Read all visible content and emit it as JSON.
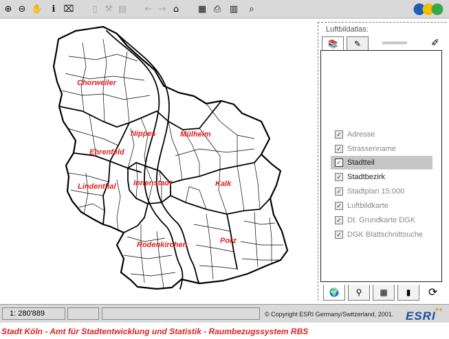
{
  "toolbar": {
    "buttons": [
      {
        "name": "zoom-in-icon",
        "glyph": "⊕"
      },
      {
        "name": "zoom-out-icon",
        "glyph": "⊖"
      },
      {
        "name": "pan-hand-icon",
        "glyph": "✋"
      },
      {
        "name": "info-icon",
        "glyph": "ℹ"
      },
      {
        "name": "measure-icon",
        "glyph": "⌧"
      },
      {
        "name": "select-icon",
        "glyph": "▯"
      },
      {
        "name": "query-icon",
        "glyph": "⚒"
      },
      {
        "name": "layer-query-icon",
        "glyph": "▤"
      },
      {
        "name": "back-arrow-icon",
        "glyph": "←"
      },
      {
        "name": "forward-arrow-icon",
        "glyph": "→"
      },
      {
        "name": "home-icon",
        "glyph": "⌂"
      },
      {
        "name": "overview-map-icon",
        "glyph": "▦"
      },
      {
        "name": "print-icon",
        "glyph": "⎙"
      },
      {
        "name": "legend-book-icon",
        "glyph": "▥"
      },
      {
        "name": "find-icon",
        "glyph": "⌕"
      }
    ]
  },
  "map": {
    "districts": [
      "Chorweiler",
      "Nippes",
      "Mülheim",
      "Ehrenfeld",
      "Lindenthal",
      "Innenstadt",
      "Kalk",
      "Rodenkirchen",
      "Porz"
    ]
  },
  "panel": {
    "title": "Luftbildatlas:",
    "progress": "»»»»»»»»",
    "layers": [
      {
        "label": "Adresse",
        "checked": true,
        "active": false
      },
      {
        "label": "Strassenname",
        "checked": true,
        "active": false
      },
      {
        "label": "Stadtteil",
        "checked": true,
        "active": true
      },
      {
        "label": "Stadtbezirk",
        "checked": true,
        "active": false
      },
      {
        "label": "Stadtplan 15.000",
        "checked": true,
        "active": false
      },
      {
        "label": "Luftbildkarte",
        "checked": true,
        "active": false
      },
      {
        "label": "Dt. Grundkarte DGK",
        "checked": true,
        "active": false
      },
      {
        "label": "DGK Blattschnittsuche",
        "checked": true,
        "active": false
      }
    ]
  },
  "status": {
    "scale": "1: 280'889",
    "copyright": "© Copyright ESRI Germany/Switzerland, 2001.",
    "brand": "ESRI",
    "brand_plus": "++"
  },
  "footer": {
    "text": "Stadt Köln - Amt für Stadtentwicklung und Statistik - Raumbezugssystem RBS"
  }
}
